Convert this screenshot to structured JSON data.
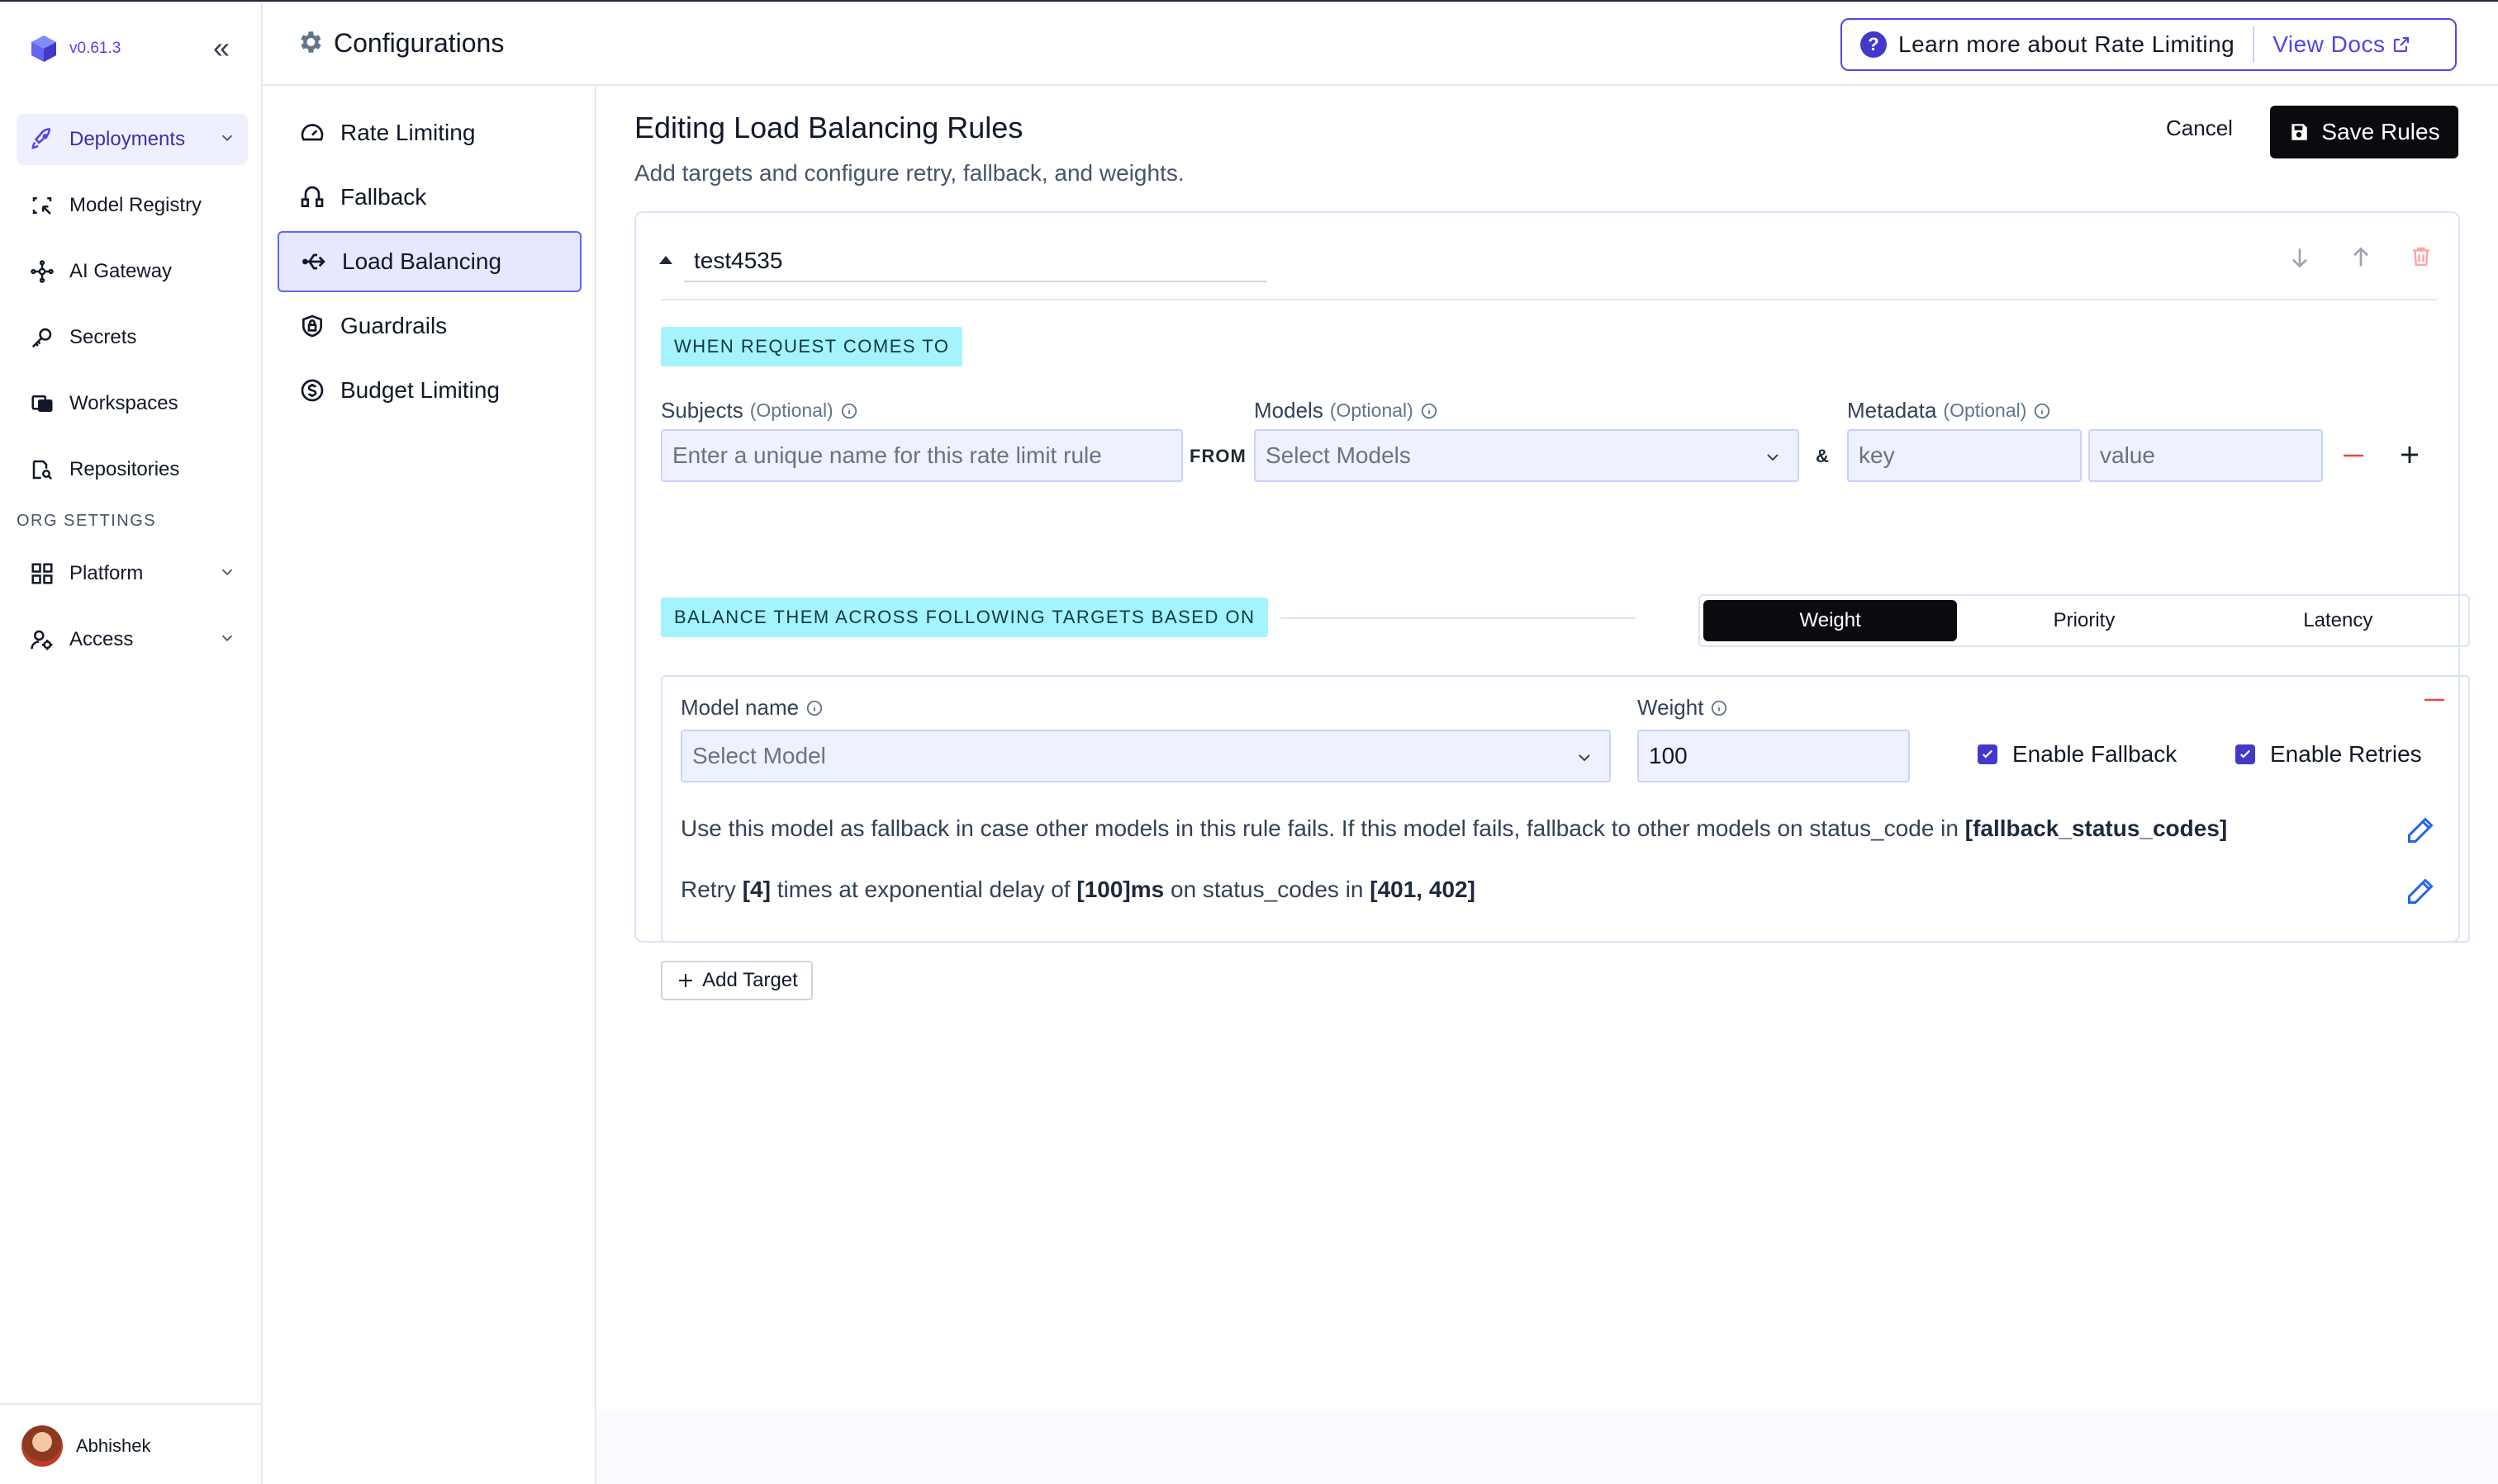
{
  "app": {
    "version": "v0.61.3"
  },
  "sidebar": {
    "items": [
      {
        "label": "Deployments",
        "icon": "rocket-icon"
      },
      {
        "label": "Model Registry",
        "icon": "model-registry-icon"
      },
      {
        "label": "AI Gateway",
        "icon": "gateway-icon"
      },
      {
        "label": "Secrets",
        "icon": "key-icon"
      },
      {
        "label": "Workspaces",
        "icon": "workspaces-icon"
      },
      {
        "label": "Repositories",
        "icon": "repositories-icon"
      }
    ],
    "org_settings_label": "ORG SETTINGS",
    "org_items": [
      {
        "label": "Platform",
        "icon": "platform-icon"
      },
      {
        "label": "Access",
        "icon": "access-icon"
      }
    ],
    "user": {
      "name": "Abhishek"
    }
  },
  "header": {
    "title": "Configurations",
    "learn_more": "Learn more about Rate Limiting",
    "view_docs": "View Docs"
  },
  "config_nav": {
    "items": [
      {
        "label": "Rate Limiting",
        "icon": "gauge-icon"
      },
      {
        "label": "Fallback",
        "icon": "fallback-icon"
      },
      {
        "label": "Load Balancing",
        "icon": "load-balancing-icon",
        "active": true
      },
      {
        "label": "Guardrails",
        "icon": "shield-lock-icon"
      },
      {
        "label": "Budget Limiting",
        "icon": "dollar-icon"
      }
    ]
  },
  "main": {
    "title": "Editing Load Balancing Rules",
    "subtitle": "Add targets and configure retry, fallback, and weights.",
    "cancel_label": "Cancel",
    "save_label": "Save Rules",
    "rule": {
      "name": "test4535",
      "when_chip": "WHEN REQUEST COMES TO",
      "subjects_label": "Subjects",
      "subjects_optional": "(Optional)",
      "subjects_placeholder": "Enter a unique name for this rate limit rule",
      "from_label": "FROM",
      "models_label": "Models",
      "models_optional": "(Optional)",
      "models_placeholder": "Select Models",
      "amp": "&",
      "metadata_label": "Metadata",
      "metadata_optional": "(Optional)",
      "key_placeholder": "key",
      "value_placeholder": "value",
      "balance_chip": "BALANCE THEM ACROSS FOLLOWING TARGETS BASED ON",
      "strategy": {
        "options": [
          "Weight",
          "Priority",
          "Latency"
        ],
        "selected": "Weight"
      },
      "target": {
        "model_name_label": "Model name",
        "model_placeholder": "Select Model",
        "weight_label": "Weight",
        "weight_value": "100",
        "enable_fallback": "Enable Fallback",
        "enable_fallback_checked": true,
        "enable_retries": "Enable Retries",
        "enable_retries_checked": true,
        "fallback_text_prefix": "Use this model as fallback in case other models in this rule fails. If this model fails, fallback to other models on status_code in ",
        "fallback_codes": "[fallback_status_codes]",
        "retry_prefix": "Retry ",
        "retry_count": "[4]",
        "retry_mid": " times at exponential delay of ",
        "retry_delay": "[100]ms",
        "retry_mid2": " on status_codes in ",
        "retry_codes": "[401, 402]"
      },
      "add_target_label": "Add Target"
    }
  },
  "colors": {
    "accent": "#4f46e5",
    "chip": "#a5f3fc",
    "danger": "#ef4444",
    "dark": "#0b0b0f"
  }
}
